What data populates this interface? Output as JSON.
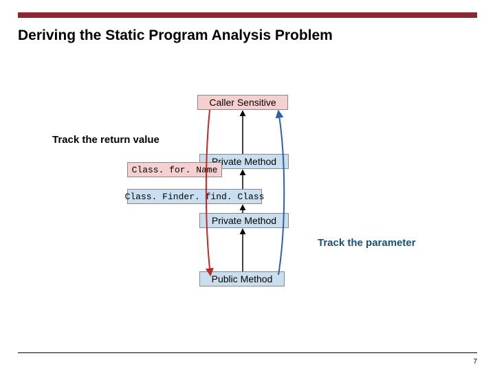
{
  "slide": {
    "title": "Deriving the Static Program Analysis Problem",
    "page_number": "7"
  },
  "labels": {
    "track_return": "Track the return value",
    "track_param": "Track the parameter"
  },
  "boxes": {
    "caller_sensitive": "Caller Sensitive",
    "private_method_1": "Private Method",
    "class_for_name": "Class. for. Name",
    "class_finder": "Class. Finder. find. Class",
    "private_method_2": "Private Method",
    "public_method": "Public Method"
  }
}
